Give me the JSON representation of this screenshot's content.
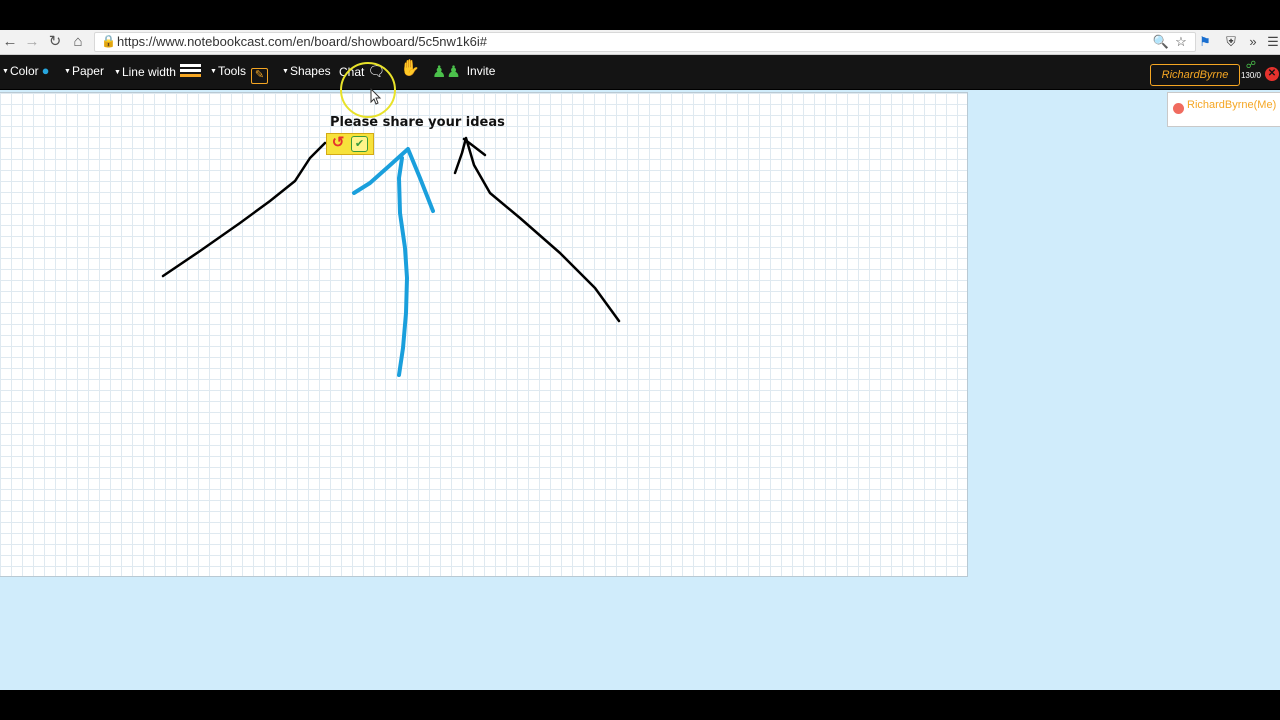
{
  "browser": {
    "url": "https://www.notebookcast.com/en/board/showboard/5c5nw1k6i#",
    "back_icon": "arrow-left-icon",
    "forward_icon": "arrow-right-icon",
    "reload_icon": "reload-icon",
    "home_icon": "home-icon",
    "more_glyph": "»"
  },
  "toolbar": {
    "color_label": "Color",
    "paper_label": "Paper",
    "line_width_label": "Line width",
    "tools_label": "Tools",
    "shapes_label": "Shapes",
    "chat_label": "Chat",
    "invite_label": "Invite",
    "user_name": "RichardByrne",
    "connection_stat": "130/0",
    "accent_color": "#f5a623",
    "drop_color": "#27a6de"
  },
  "board": {
    "title": "Please share your ideas",
    "background": "#ffffff",
    "grid_color": "#dfe9f0",
    "stroke_colors": [
      "#000000",
      "#1a9fdc"
    ]
  },
  "users_panel": {
    "entry": "RichardByrne(Me)",
    "status_color": "#f06b5f"
  },
  "workspace_color": "#d0ecfb"
}
